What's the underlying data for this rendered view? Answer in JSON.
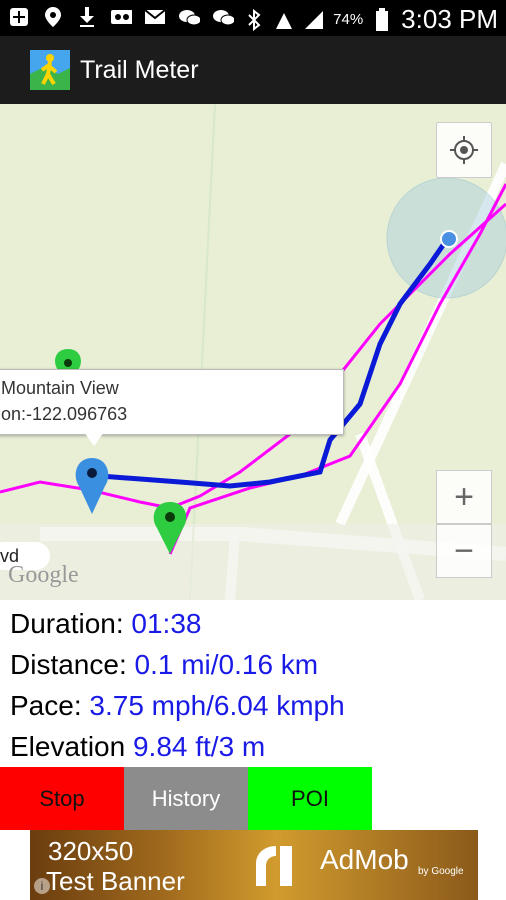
{
  "status_bar": {
    "time": "3:03 PM",
    "battery": "74%",
    "network": "4G LTE"
  },
  "app": {
    "title": "Trail Meter"
  },
  "map": {
    "info_window": {
      "line1": "Mountain View",
      "line2": "on:-122.096763"
    },
    "road_label": "vd",
    "attribution": "Google",
    "zoom_in": "+",
    "zoom_out": "−"
  },
  "stats": {
    "duration_label": "Duration:",
    "duration_value": "01:38",
    "distance_label": "Distance:",
    "distance_value": "0.1 mi/0.16 km",
    "pace_label": "Pace:",
    "pace_value": "3.75 mph/6.04 kmph",
    "elevation_label": "Elevation",
    "elevation_value": "9.84 ft/3 m"
  },
  "buttons": {
    "stop": "Stop",
    "history": "History",
    "poi": "POI"
  },
  "ad": {
    "size": "320x50",
    "label": "Test Banner",
    "brand": "AdMob",
    "by": "by Google",
    "info": "i"
  },
  "colors": {
    "track_blue": "#0a1ad6",
    "track_magenta": "#ff00ff",
    "value_text": "#1a1ae6",
    "stop_button": "#ff0000",
    "history_button": "#8c8c8c",
    "poi_button": "#00ff00"
  }
}
